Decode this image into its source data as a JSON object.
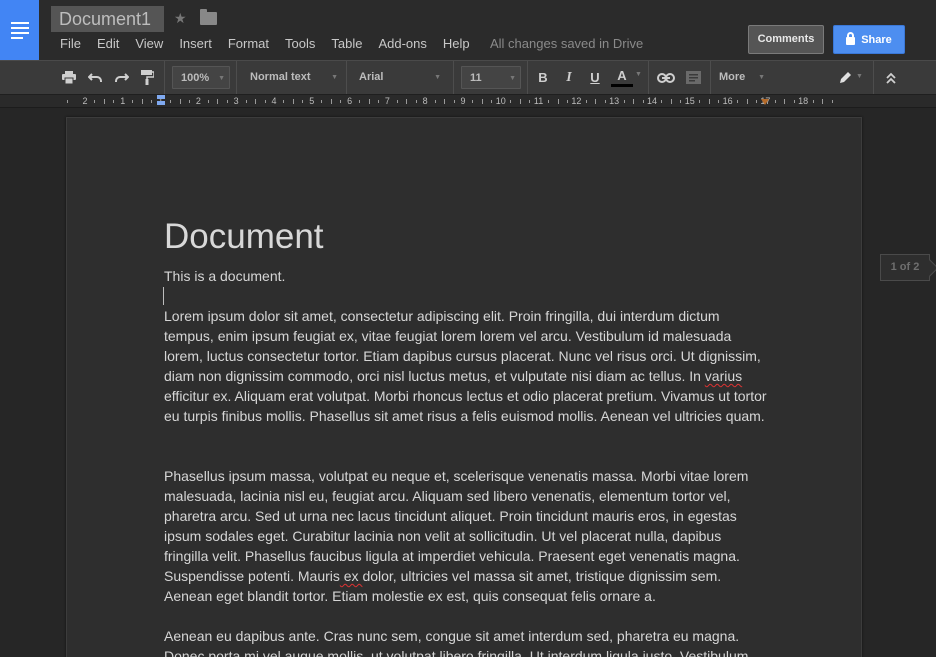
{
  "header": {
    "title": "Document1",
    "menus": [
      "File",
      "Edit",
      "View",
      "Insert",
      "Format",
      "Tools",
      "Table",
      "Add-ons",
      "Help"
    ],
    "save_status": "All changes saved in Drive",
    "comments_label": "Comments",
    "share_label": "Share"
  },
  "toolbar": {
    "zoom": "100%",
    "style": "Normal text",
    "font": "Arial",
    "font_size": "11",
    "bold_label": "B",
    "italic_label": "I",
    "underline_label": "U",
    "text_color_label": "A",
    "more_label": "More",
    "text_color": "#000000"
  },
  "ruler": {
    "labels": [
      "2",
      "1",
      "1",
      "2",
      "3",
      "4",
      "5",
      "6",
      "7",
      "8",
      "9",
      "10",
      "11",
      "12",
      "13",
      "14",
      "15",
      "16",
      "17",
      "18"
    ]
  },
  "document": {
    "heading": "Document",
    "subtitle": "This is a document.",
    "paragraphs": [
      "Lorem ipsum dolor sit amet, consectetur adipiscing elit. Proin fringilla, dui interdum dictum tempus, enim ipsum feugiat ex, vitae feugiat lorem lorem vel arcu. Vestibulum id malesuada lorem, luctus consectetur tortor. Etiam dapibus cursus placerat. Nunc vel risus orci. Ut dignissim, diam non dignissim commodo, orci nisl luctus metus, et vulputate nisi diam ac tellus. In varius efficitur ex. Aliquam erat volutpat. Morbi rhoncus lectus et odio placerat pretium. Vivamus ut tortor eu turpis finibus mollis. Phasellus sit amet risus a felis euismod mollis. Aenean vel ultricies quam.",
      "Phasellus ipsum massa, volutpat eu neque et, scelerisque venenatis massa. Morbi vitae lorem malesuada, lacinia nisl eu, feugiat arcu. Aliquam sed libero venenatis, elementum tortor vel, pharetra arcu. Sed ut urna nec lacus tincidunt aliquet. Proin tincidunt mauris eros, in egestas ipsum sodales eget. Curabitur lacinia non velit at sollicitudin. Ut vel placerat nulla, dapibus fringilla velit. Phasellus faucibus ligula at imperdiet vehicula. Praesent eget venenatis magna. Suspendisse potenti. Mauris ex dolor, ultricies vel massa sit amet, tristique dignissim sem. Aenean eget blandit tortor. Etiam molestie ex est, quis consequat felis ornare a.",
      "Aenean eu dapibus ante. Cras nunc sem, congue sit amet interdum sed, pharetra eu magna. Donec porta mi vel augue mollis, ut volutpat libero fringilla. Ut interdum ligula justo. Vestibulum"
    ]
  },
  "page_indicator": "1 of 2",
  "icons": [
    "docs-logo-icon",
    "star-icon",
    "folder-icon",
    "lock-icon",
    "print-icon",
    "undo-icon",
    "redo-icon",
    "paint-format-icon",
    "link-icon",
    "comment-icon",
    "pencil-icon",
    "collapse-icon"
  ],
  "colors": {
    "accent": "#4285f4",
    "share": "#4d8ef0",
    "background": "#262626"
  }
}
